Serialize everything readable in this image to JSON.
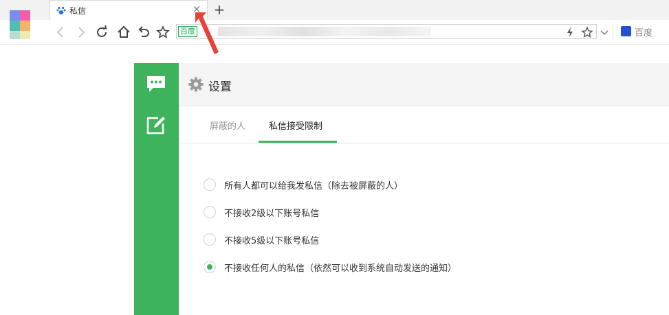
{
  "browser": {
    "tab": {
      "title": "私信",
      "close_symbol": "×"
    },
    "new_tab_symbol": "+",
    "address": {
      "badge": "百度"
    },
    "search": {
      "engine_label": "百度"
    }
  },
  "page": {
    "title": "设置",
    "tabs": [
      {
        "label": "屏蔽的人",
        "active": false
      },
      {
        "label": "私信接受限制",
        "active": true
      }
    ],
    "options": [
      {
        "label": "所有人都可以给我发私信（除去被屏蔽的人）",
        "checked": false
      },
      {
        "label": "不接收2级以下账号私信",
        "checked": false
      },
      {
        "label": "不接收5级以下账号私信",
        "checked": false
      },
      {
        "label": "不接收任何人的私信（依然可以收到系统自动发送的通知）",
        "checked": true
      }
    ]
  },
  "colors": {
    "accent": "#3db35c",
    "annotation": "#e8433a"
  }
}
